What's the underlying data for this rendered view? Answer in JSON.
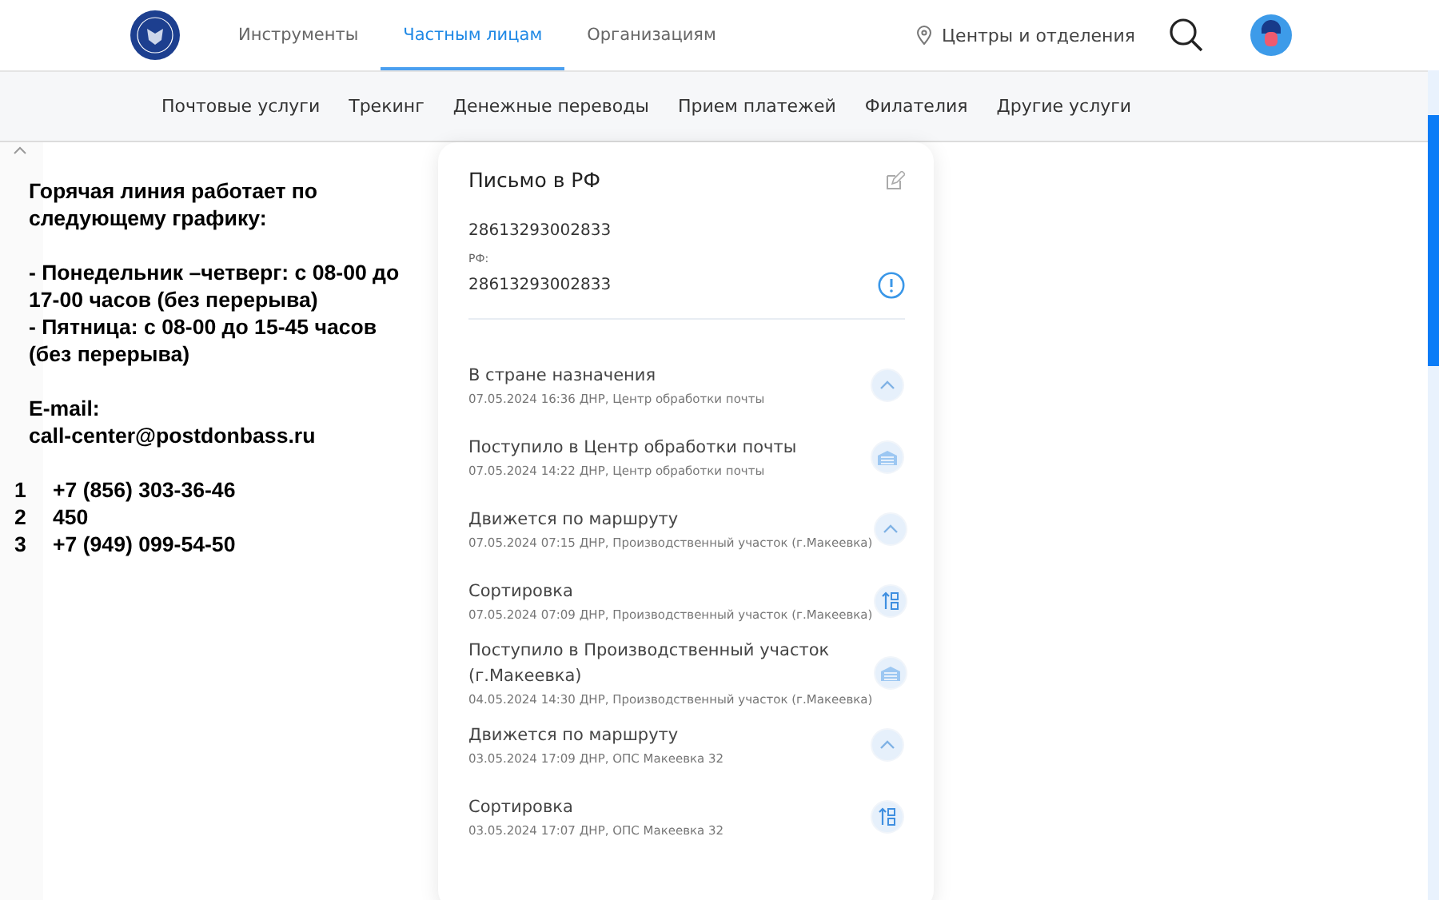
{
  "header": {
    "nav": [
      {
        "label": "Инструменты",
        "selected": false
      },
      {
        "label": "Частным лицам",
        "selected": true
      },
      {
        "label": "Организациям",
        "selected": false
      }
    ],
    "location": "Центры и отделения"
  },
  "subnav": [
    "Почтовые услуги",
    "Трекинг",
    "Денежные переводы",
    "Прием платежей",
    "Филателия",
    "Другие услуги"
  ],
  "hotline": {
    "heading": "Горячая линия работает по следующему графику:",
    "schedule": [
      "- Понедельник –четверг: с 08-00 до 17-00 часов (без перерыва)",
      "- Пятница: с 08-00 до 15-45 часов (без перерыва)"
    ],
    "email_label": "E-mail:",
    "email": "call-center@postdonbass.ru",
    "phones": [
      {
        "index": "1",
        "number": "+7 (856) 303-36-46"
      },
      {
        "index": "2",
        "number": "450"
      },
      {
        "index": "3",
        "number": "+7 (949) 099-54-50"
      }
    ]
  },
  "card": {
    "title": "Письмо в РФ",
    "tracking_number": "28613293002833",
    "rf_label": "РФ:",
    "rf_number": "28613293002833",
    "events": [
      {
        "title": "В стране назначения",
        "detail": "07.05.2024 16:36 ДНР, Центр обработки почты",
        "kind": "route"
      },
      {
        "title": "Поступило в Центр обработки почты",
        "detail": "07.05.2024 14:22 ДНР, Центр обработки почты",
        "kind": "arrival"
      },
      {
        "title": "Движется по маршруту",
        "detail": "07.05.2024 07:15 ДНР, Производственный участок (г.Макеевка)",
        "kind": "route"
      },
      {
        "title": "Сортировка",
        "detail": "07.05.2024 07:09 ДНР, Производственный участок (г.Макеевка)",
        "kind": "sorting"
      },
      {
        "title": "Поступило в Производственный участок (г.Макеевка)",
        "detail": "04.05.2024 14:30 ДНР, Производственный участок (г.Макеевка)",
        "kind": "arrival"
      },
      {
        "title": "Движется по маршруту",
        "detail": "03.05.2024 17:09 ДНР, ОПС Макеевка 32",
        "kind": "route"
      },
      {
        "title": "Сортировка",
        "detail": "03.05.2024 17:07 ДНР, ОПС Макеевка 32",
        "kind": "sorting"
      }
    ]
  }
}
